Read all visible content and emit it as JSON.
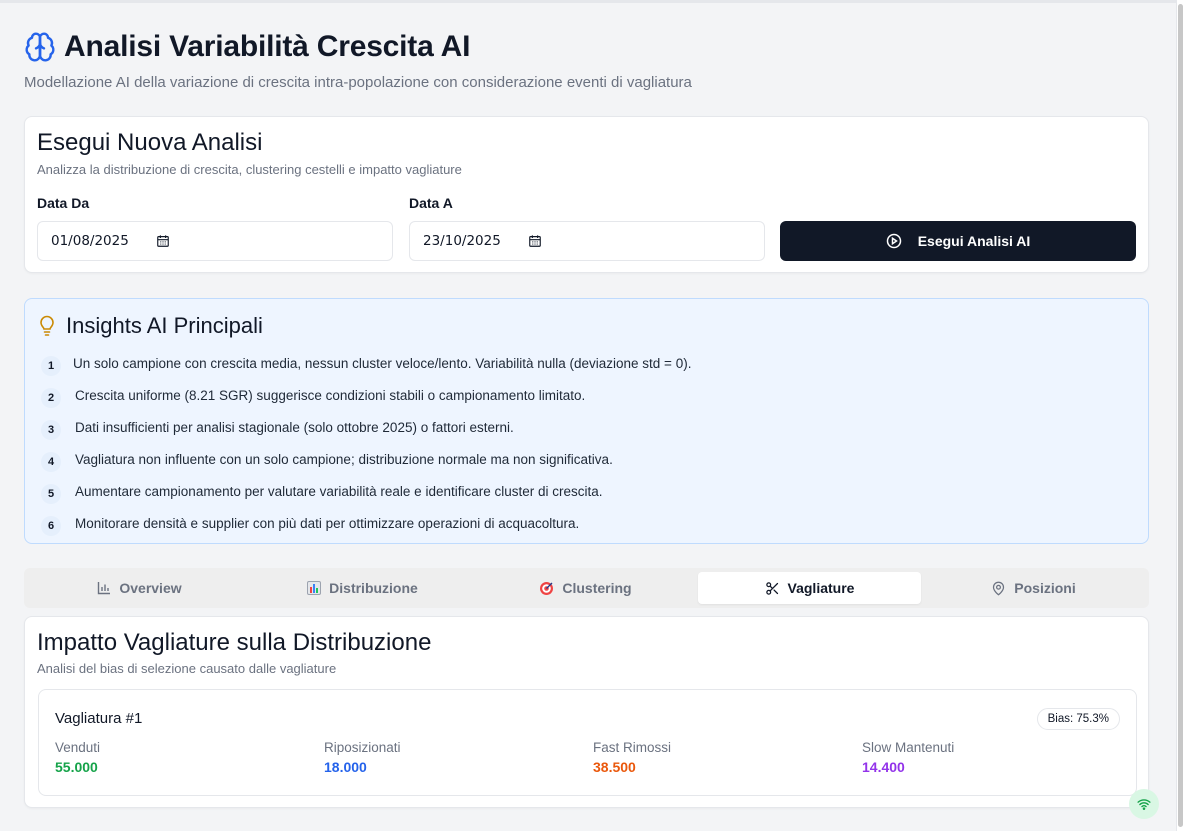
{
  "header": {
    "title": "Analisi Variabilità Crescita AI",
    "subtitle": "Modellazione AI della variazione di crescita intra-popolazione con considerazione eventi di vagliatura"
  },
  "run": {
    "title": "Esegui Nuova Analisi",
    "subtitle": "Analizza la distribuzione di crescita, clustering cestelli e impatto vagliature",
    "date_from_label": "Data Da",
    "date_from_value": "01/08/2025",
    "date_to_label": "Data A",
    "date_to_value": "23/10/2025",
    "button_label": "Esegui Analisi AI"
  },
  "insights": {
    "title": "Insights AI Principali",
    "items": [
      {
        "n": "1",
        "text": "Un solo campione con crescita media, nessun cluster veloce/lento. Variabilità nulla (deviazione std = 0)."
      },
      {
        "n": "2",
        "text": "Crescita uniforme (8.21 SGR) suggerisce condizioni stabili o campionamento limitato."
      },
      {
        "n": "3",
        "text": "Dati insufficienti per analisi stagionale (solo ottobre 2025) o fattori esterni."
      },
      {
        "n": "4",
        "text": "Vagliatura non influente con un solo campione; distribuzione normale ma non significativa."
      },
      {
        "n": "5",
        "text": "Aumentare campionamento per valutare variabilità reale e identificare cluster di crescita."
      },
      {
        "n": "6",
        "text": "Monitorare densità e supplier con più dati per ottimizzare operazioni di acquacoltura."
      }
    ]
  },
  "tabs": [
    {
      "label": "Overview",
      "icon": "bar-chart-icon"
    },
    {
      "label": "Distribuzione",
      "icon": "bar-chart-emoji-icon"
    },
    {
      "label": "Clustering",
      "icon": "target-icon"
    },
    {
      "label": "Vagliature",
      "icon": "scissors-icon",
      "active": true
    },
    {
      "label": "Posizioni",
      "icon": "map-pin-icon"
    }
  ],
  "impact": {
    "title": "Impatto Vagliature sulla Distribuzione",
    "subtitle": "Analisi del bias di selezione causato dalle vagliature",
    "vagliatura": {
      "title": "Vagliatura #1",
      "bias": "Bias: 75.3%",
      "stats": [
        {
          "label": "Venduti",
          "value": "55.000",
          "color": "#16a34a"
        },
        {
          "label": "Riposizionati",
          "value": "18.000",
          "color": "#2563eb"
        },
        {
          "label": "Fast Rimossi",
          "value": "38.500",
          "color": "#ea580c"
        },
        {
          "label": "Slow Mantenuti",
          "value": "14.400",
          "color": "#9333ea"
        }
      ]
    }
  }
}
